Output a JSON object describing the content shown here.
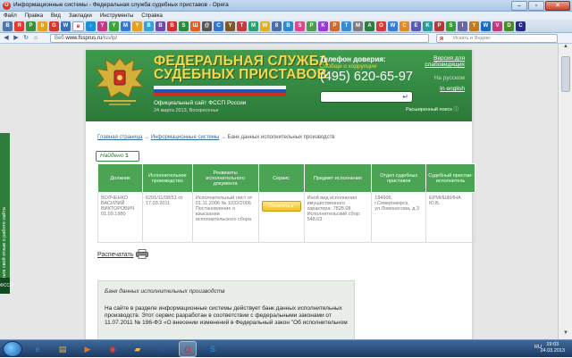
{
  "window": {
    "title": "Информационные системы - Федеральная служба судебных приставов - Opera",
    "app_icon": "opera-icon"
  },
  "menu": [
    "Файл",
    "Правка",
    "Вид",
    "Закладки",
    "Инструменты",
    "Справка"
  ],
  "tabs": [
    {
      "icon": "vk-icon",
      "color": "#4a76a8",
      "glyph": "В"
    },
    {
      "icon": "yandex-icon",
      "color": "#e23a2e",
      "glyph": "Я"
    },
    {
      "icon": "tab-icon",
      "color": "#3b8f3b",
      "glyph": "P"
    },
    {
      "icon": "tab-icon",
      "color": "#e8a21a",
      "glyph": "b"
    },
    {
      "icon": "tab-icon",
      "color": "#d4362c",
      "glyph": "G"
    },
    {
      "icon": "tab-icon",
      "color": "#3a6fb5",
      "glyph": "W"
    },
    {
      "icon": "tab-icon",
      "color": "#6c6c6c",
      "glyph": "е"
    },
    {
      "icon": "tab-icon",
      "color": "#1d8fd8",
      "glyph": "♪"
    },
    {
      "icon": "tab-icon",
      "color": "#c23a86",
      "glyph": "Y"
    },
    {
      "icon": "tab-icon",
      "color": "#3ea23e",
      "glyph": "Y"
    },
    {
      "icon": "tab-icon",
      "color": "#2f7ad6",
      "glyph": "M"
    },
    {
      "icon": "tab-icon",
      "color": "#e3a020",
      "glyph": "Y"
    },
    {
      "icon": "tab-icon",
      "color": "#35a0d8",
      "glyph": "B"
    },
    {
      "icon": "tab-icon",
      "color": "#6b4aa8",
      "glyph": "B"
    },
    {
      "icon": "tab-icon",
      "color": "#d23030",
      "glyph": "B"
    },
    {
      "icon": "tab-icon",
      "color": "#2f8a3d",
      "glyph": "S"
    },
    {
      "icon": "tab-icon",
      "color": "#e65c1a",
      "glyph": "Ш"
    },
    {
      "icon": "tab-icon",
      "color": "#555555",
      "glyph": "@"
    },
    {
      "icon": "tab-icon",
      "color": "#3478c8",
      "glyph": "C"
    },
    {
      "icon": "tab-icon",
      "color": "#7a5a2a",
      "glyph": "Y"
    },
    {
      "icon": "tab-icon",
      "color": "#c83a3a",
      "glyph": "T"
    },
    {
      "icon": "tab-icon",
      "color": "#2f9e6e",
      "glyph": "M"
    },
    {
      "icon": "tab-icon",
      "color": "#e0b020",
      "glyph": "W"
    },
    {
      "icon": "tab-icon",
      "color": "#4a6fa8",
      "glyph": "8"
    },
    {
      "icon": "tab-icon",
      "color": "#2a8ad0",
      "glyph": "B"
    },
    {
      "icon": "tab-icon",
      "color": "#d84a8a",
      "glyph": "S"
    },
    {
      "icon": "tab-icon",
      "color": "#4aa04a",
      "glyph": "P"
    },
    {
      "icon": "tab-icon",
      "color": "#9a3ad0",
      "glyph": "K"
    },
    {
      "icon": "tab-icon",
      "color": "#d06a2a",
      "glyph": "P"
    },
    {
      "icon": "tab-icon",
      "color": "#3a8ad0",
      "glyph": "T"
    },
    {
      "icon": "tab-icon",
      "color": "#7d7d7d",
      "glyph": "M"
    },
    {
      "icon": "tab-icon",
      "color": "#2f7d3a",
      "glyph": "А"
    },
    {
      "icon": "tab-icon",
      "color": "#d43a3a",
      "glyph": "O"
    },
    {
      "icon": "tab-icon",
      "color": "#3a7ad0",
      "glyph": "W"
    },
    {
      "icon": "tab-icon",
      "color": "#e08a2a",
      "glyph": "C"
    },
    {
      "icon": "tab-icon",
      "color": "#5a5ab0",
      "glyph": "E"
    },
    {
      "icon": "tab-icon",
      "color": "#2a9a9a",
      "glyph": "K"
    },
    {
      "icon": "tab-icon",
      "color": "#b03a3a",
      "glyph": "P"
    },
    {
      "icon": "tab-icon",
      "color": "#3a9a3a",
      "glyph": "S"
    },
    {
      "icon": "tab-icon",
      "color": "#6a6a9a",
      "glyph": "I"
    },
    {
      "icon": "tab-icon",
      "color": "#c07a1a",
      "glyph": "Y"
    },
    {
      "icon": "tab-icon",
      "color": "#1a6ac0",
      "glyph": "W"
    },
    {
      "icon": "tab-icon",
      "color": "#c03a7a",
      "glyph": "V"
    },
    {
      "icon": "tab-icon",
      "color": "#4a8a2a",
      "glyph": "D"
    },
    {
      "icon": "tab-icon",
      "color": "#2a2a8a",
      "glyph": "C"
    }
  ],
  "address": {
    "prefix": "Веб",
    "host": "www.fssprus.ru",
    "path": "/iss/ip/",
    "search_placeholder": "Искать в Яндекс"
  },
  "sidebar": {
    "label": "Оставьте свой отзыв о работе сайта",
    "mark": "ФССП"
  },
  "header": {
    "title_line1": "ФЕДЕРАЛЬНАЯ СЛУЖБА",
    "title_line2": "СУДЕБНЫХ ПРИСТАВОВ",
    "subtitle": "Официальный сайт ФССП России",
    "date": "24 марта 2013, Воскресенье",
    "hotline_label": "Телефон доверия:",
    "hotline_sub": "Сообщи о коррупции",
    "phone": "(495) 620-65-97",
    "advanced_search": "Расширенный поиск",
    "links": {
      "impaired": "Версия для слабовидящих",
      "russian": "На русском",
      "english": "In english"
    }
  },
  "breadcrumb": {
    "home": "Главная страница",
    "sep": "→",
    "section": "Информационные системы",
    "current": "Банк данных исполнительных производств"
  },
  "found": {
    "label": "Найдено",
    "count": "1"
  },
  "table": {
    "headers": [
      "Должник",
      "Исполнительное производство",
      "Реквизиты исполнительного документа",
      "Сервис",
      "Предмет исполнения",
      "Отдел судебных приставов",
      "Судебный пристав-исполнитель"
    ],
    "row": {
      "debtor": "ВОЛЧЕНКО ВАСИЛИЙ ВИКТОРОВИЧ 01.09.1980",
      "proceeding": "6291/11/08/51 от 17.03.2011",
      "document": "Исполнительный лист от 01.11.2006 № 1032/2006 Постановление о взыскании исполнительского сбора",
      "service_button": "Оплатить",
      "subject": "Иной вид исполнения имущественного характера: 7828.08 Исполнительский сбор: 548.03",
      "department": "184606, г.Североморск, ул.Ломоносова, д.3",
      "bailiff": "ЕРМИШКИНА Ю.В."
    }
  },
  "print": {
    "label": "Распечатать"
  },
  "info": {
    "title": "Банк данных исполнительных производств",
    "text": "На сайте в разделе информационные системы действует банк данных исполнительных производств. Этот сервис разработан в соответствии с федеральными законами от 11.07.2011 № 196-ФЗ «О внесении изменений в Федеральный закон \"Об исполнительном"
  },
  "taskbar": {
    "apps": [
      {
        "icon": "ie-icon",
        "glyph": "e"
      },
      {
        "icon": "explorer-icon",
        "glyph": "▤"
      },
      {
        "icon": "media-player-icon",
        "glyph": "▶"
      },
      {
        "icon": "chrome-icon",
        "glyph": "◉"
      },
      {
        "icon": "folder-icon",
        "glyph": "▰"
      },
      {
        "icon": "word-icon",
        "glyph": "W"
      },
      {
        "icon": "opera-icon",
        "glyph": "O"
      },
      {
        "icon": "skype-icon",
        "glyph": "S"
      }
    ],
    "lang": "RU",
    "time": "19:03",
    "date": "24.03.2013"
  }
}
